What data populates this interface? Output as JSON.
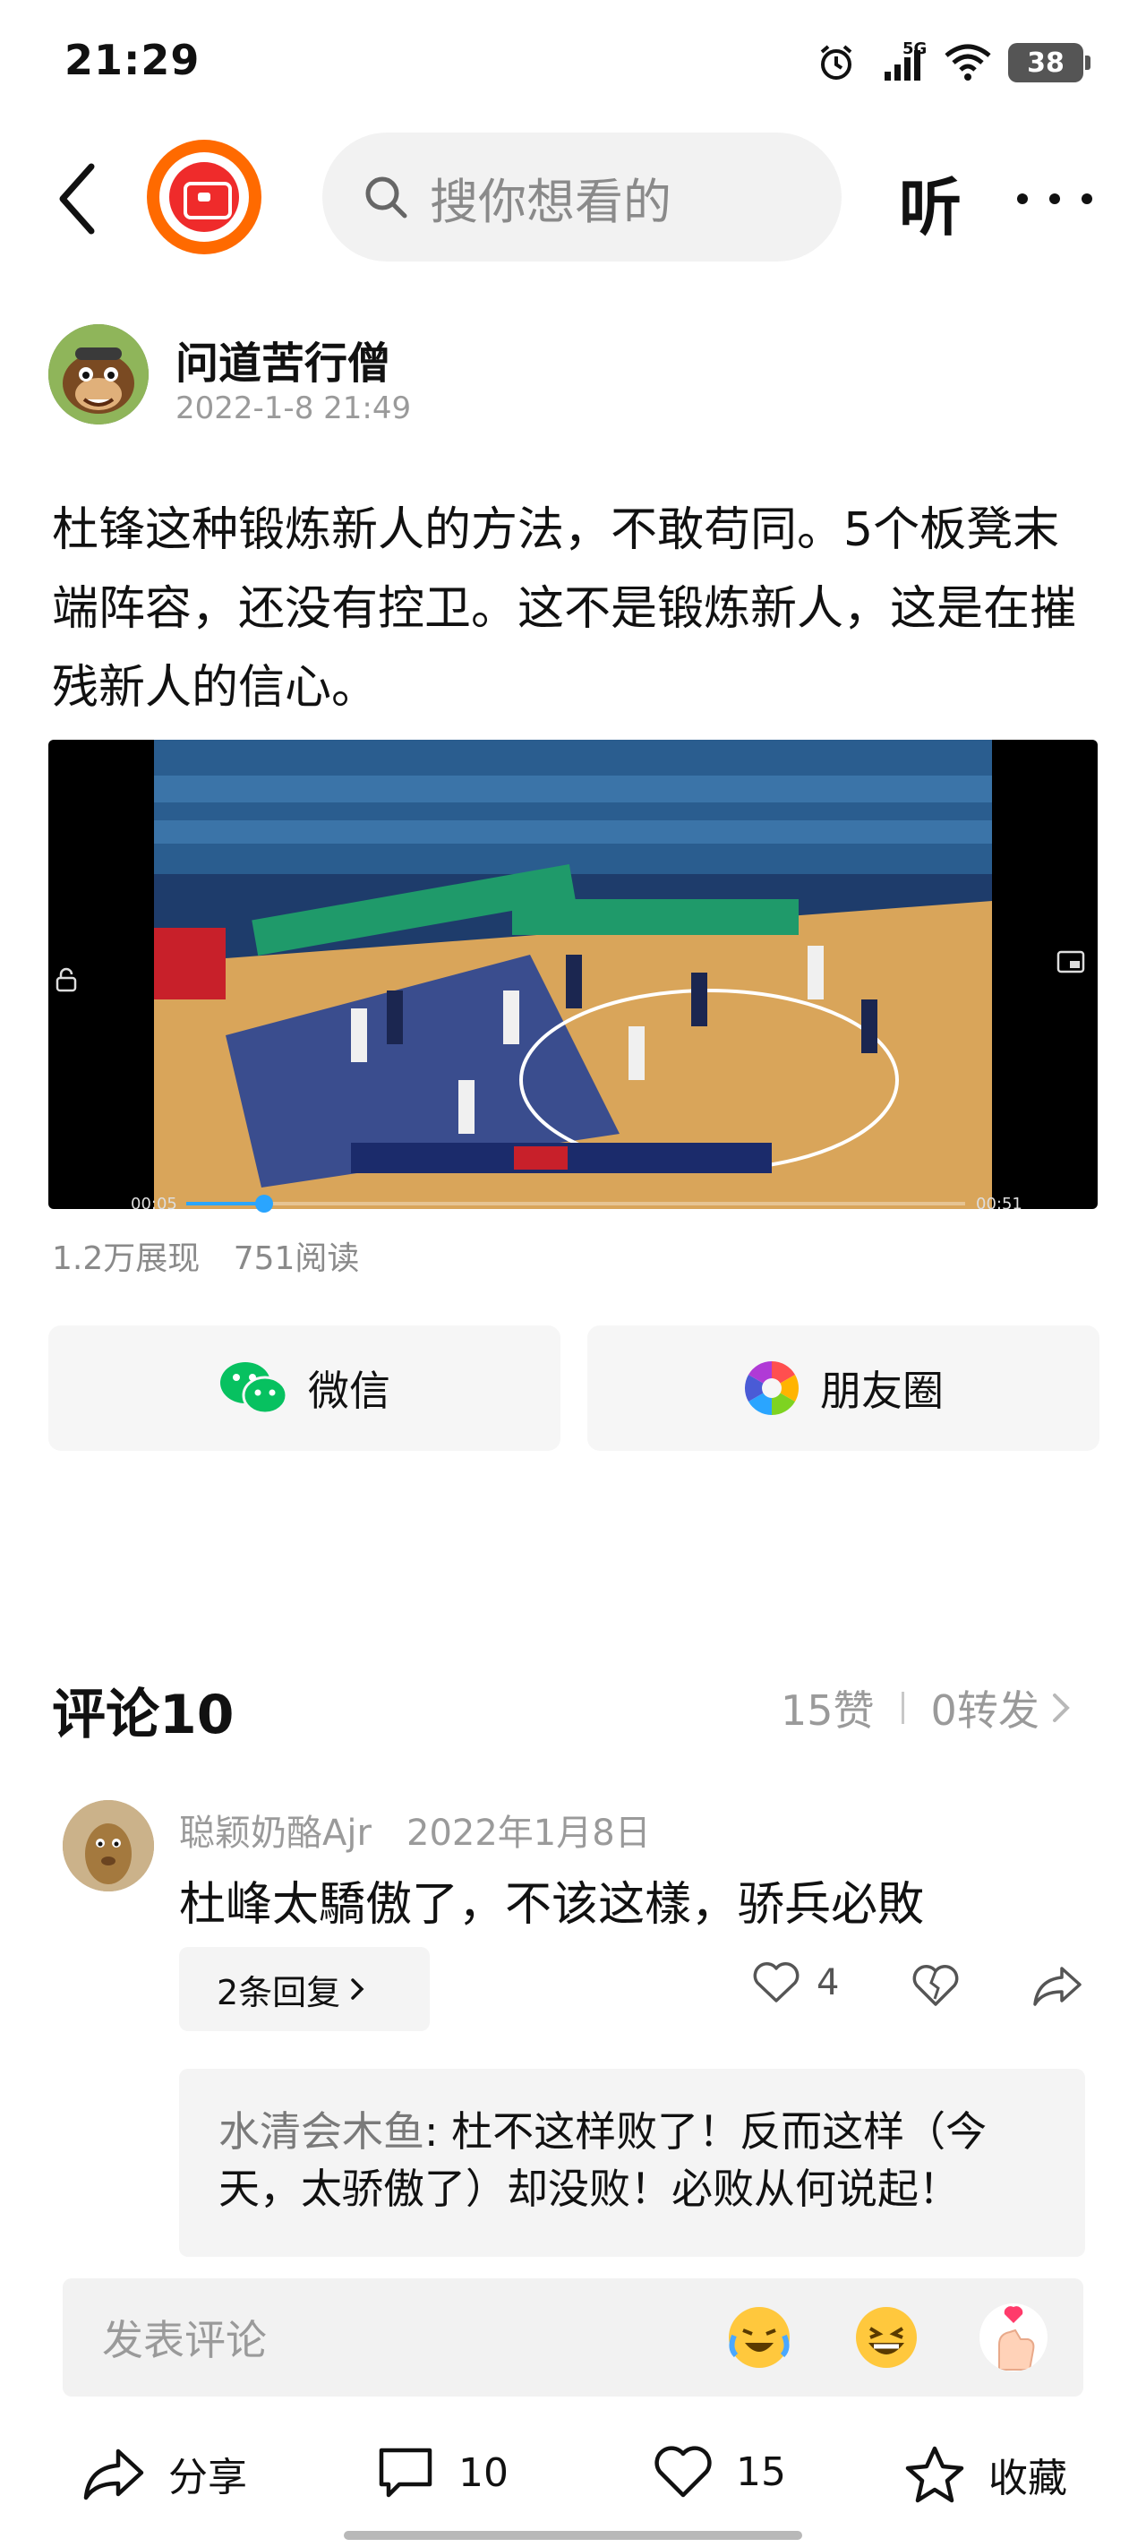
{
  "status_bar": {
    "time": "21:29",
    "network": "5G",
    "battery": "38"
  },
  "header": {
    "search_placeholder": "搜你想看的",
    "listen_label": "听"
  },
  "post": {
    "author": "问道苦行僧",
    "date": "2022-1-8 21:49",
    "text": "杜锋这种锻炼新人的方法，不敢苟同。5个板凳末端阵容，还没有控卫。这不是锻炼新人，这是在摧残新人的信心。",
    "video": {
      "current_time": "00:05",
      "duration": "00:51",
      "progress": 0.1
    },
    "impressions": "1.2万展现",
    "reads": "751阅读"
  },
  "share": {
    "wechat_label": "微信",
    "moments_label": "朋友圈"
  },
  "comments": {
    "title": "评论10",
    "likes_label": "15赞",
    "reposts_label": "0转发",
    "items": [
      {
        "user": "聪颖奶酪Ajr",
        "date": "2022年1月8日",
        "text": "杜峰太驕傲了，不该这樣，骄兵必敗",
        "replies_label": "2条回复",
        "likes": "4",
        "replies": [
          {
            "author": "水清会木鱼",
            "text": ": 杜不这样败了！反而这样（今天，太骄傲了）却没败！必败从何说起！"
          }
        ]
      }
    ]
  },
  "comment_input": {
    "placeholder": "发表评论"
  },
  "bottom_bar": {
    "share_label": "分享",
    "comment_count": "10",
    "like_count": "15",
    "favorite_label": "收藏"
  },
  "colors": {
    "accent_blue": "#2aa5ff",
    "logo_orange": "#ff6a00",
    "logo_red": "#ef2b2b",
    "wechat_green": "#07c160"
  }
}
